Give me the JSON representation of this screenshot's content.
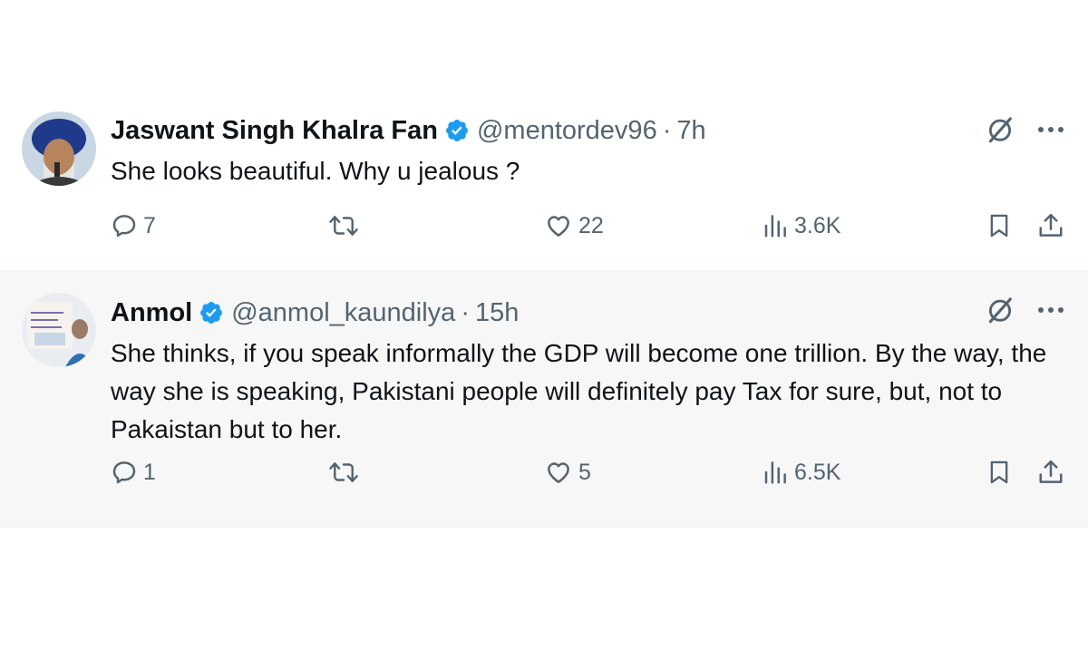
{
  "tweets": [
    {
      "name": "Jaswant Singh Khalra Fan",
      "handle": "@mentordev96",
      "separator": "·",
      "time": "7h",
      "text": "She looks beautiful. Why u jealous ?",
      "replies": "7",
      "likes": "22",
      "views": "3.6K"
    },
    {
      "name": "Anmol",
      "handle": "@anmol_kaundilya",
      "separator": "·",
      "time": "15h",
      "text": "She thinks, if you speak informally the GDP will become one trillion. By the way, the way she is speaking, Pakistani people will definitely pay Tax for sure, but, not to Pakaistan but to her.",
      "replies": "1",
      "likes": "5",
      "views": "6.5K"
    }
  ],
  "icons": {
    "verified": "verified-badge-icon",
    "grok": "grok-icon",
    "more": "more-icon",
    "reply": "reply-icon",
    "retweet": "retweet-icon",
    "like": "heart-icon",
    "views": "views-icon",
    "bookmark": "bookmark-icon",
    "share": "share-icon"
  },
  "colors": {
    "text": "#0f1419",
    "secondary": "#536471",
    "verified": "#1d9bf0",
    "alt_background": "#f7f7f7"
  }
}
